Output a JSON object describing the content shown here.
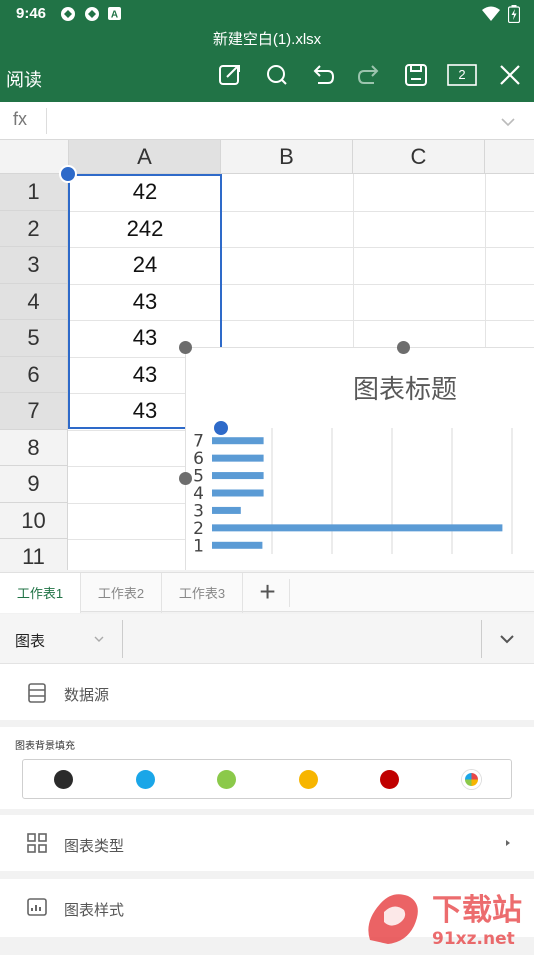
{
  "status": {
    "time": "9:46"
  },
  "toolbar": {
    "filename": "新建空白(1).xlsx",
    "mode": "阅读",
    "window_count": "2"
  },
  "formula": {
    "fx": "fx",
    "value": ""
  },
  "sheet": {
    "columns": [
      "A",
      "B",
      "C"
    ],
    "rows": [
      "1",
      "2",
      "3",
      "4",
      "5",
      "6",
      "7",
      "8",
      "9",
      "10",
      "11"
    ],
    "colA_values": [
      "42",
      "242",
      "24",
      "43",
      "43",
      "43",
      "43"
    ]
  },
  "chart_data": {
    "type": "bar",
    "orientation": "horizontal",
    "title": "图表标题",
    "categories": [
      "1",
      "2",
      "3",
      "4",
      "5",
      "6",
      "7"
    ],
    "values": [
      42,
      242,
      24,
      43,
      43,
      43,
      43
    ],
    "xlim": [
      0,
      250
    ],
    "grid": true,
    "color": "#5b9bd5"
  },
  "tabs": [
    "工作表1",
    "工作表2",
    "工作表3"
  ],
  "panel": {
    "title": "图表",
    "data_source": "数据源",
    "bg_fill_label": "图表背景填充",
    "chart_type": "图表类型",
    "chart_style": "图表样式"
  },
  "swatch_colors": [
    "#2b2b2b",
    "#1aa6e8",
    "#8bc94a",
    "#f7b500",
    "#c00000",
    "multicolor"
  ],
  "watermark": {
    "text": "下载站",
    "sub": "91xz.net"
  },
  "colors": {
    "accent": "#217346",
    "selection": "#2e6ac9",
    "bar": "#5b9bd5"
  }
}
